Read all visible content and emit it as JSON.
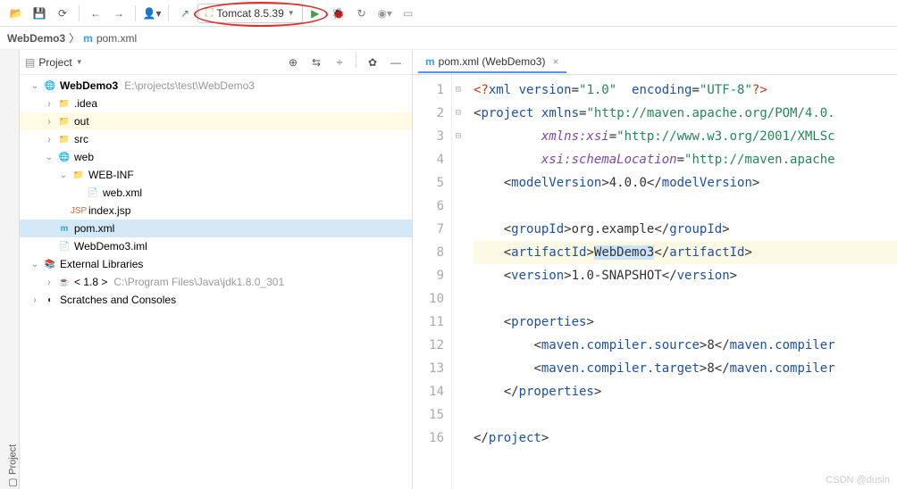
{
  "toolbar": {
    "run_config_label": "Tomcat 8.5.39"
  },
  "breadcrumb": {
    "project": "WebDemo3",
    "file": "pom.xml"
  },
  "project_pane": {
    "title": "Project",
    "tab_label": "Project"
  },
  "tree": [
    {
      "indent": 0,
      "arrow": "down",
      "icon": "folder-web",
      "label": "WebDemo3",
      "bold": true,
      "dim": "E:\\projects\\test\\WebDemo3",
      "cls": ""
    },
    {
      "indent": 1,
      "arrow": "right",
      "icon": "folder-gray",
      "label": ".idea",
      "dim": "",
      "cls": ""
    },
    {
      "indent": 1,
      "arrow": "right",
      "icon": "folder-out",
      "label": "out",
      "dim": "",
      "cls": "highlight"
    },
    {
      "indent": 1,
      "arrow": "right",
      "icon": "folder",
      "label": "src",
      "dim": "",
      "cls": ""
    },
    {
      "indent": 1,
      "arrow": "down",
      "icon": "folder-web",
      "label": "web",
      "dim": "",
      "cls": ""
    },
    {
      "indent": 2,
      "arrow": "down",
      "icon": "folder-gray",
      "label": "WEB-INF",
      "dim": "",
      "cls": ""
    },
    {
      "indent": 3,
      "arrow": "",
      "icon": "file-xml",
      "label": "web.xml",
      "dim": "",
      "cls": ""
    },
    {
      "indent": 2,
      "arrow": "",
      "icon": "file-jsp",
      "label": "index.jsp",
      "dim": "",
      "cls": ""
    },
    {
      "indent": 1,
      "arrow": "",
      "icon": "file-m",
      "label": "pom.xml",
      "dim": "",
      "cls": "selected"
    },
    {
      "indent": 1,
      "arrow": "",
      "icon": "file-generic",
      "label": "WebDemo3.iml",
      "dim": "",
      "cls": ""
    },
    {
      "indent": 0,
      "arrow": "down",
      "icon": "lib",
      "label": "External Libraries",
      "dim": "",
      "cls": ""
    },
    {
      "indent": 1,
      "arrow": "right",
      "icon": "jdk",
      "label": "< 1.8 >",
      "dim": "C:\\Program Files\\Java\\jdk1.8.0_301",
      "cls": ""
    },
    {
      "indent": 0,
      "arrow": "right",
      "icon": "scratch",
      "label": "Scratches and Consoles",
      "dim": "",
      "cls": ""
    }
  ],
  "editor": {
    "tab_label": "pom.xml (WebDemo3)",
    "lines": 16,
    "content": {
      "xml_decl": {
        "version": "1.0",
        "encoding": "UTF-8"
      },
      "project_attrs": {
        "xmlns": "http://maven.apache.org/POM/4.0.",
        "xmlns_xsi": "http://www.w3.org/2001/XMLSc",
        "xsi_schemaLocation": "http://maven.apache"
      },
      "modelVersion": "4.0.0",
      "groupId": "org.example",
      "artifactId": "WebDemo3",
      "version": "1.0-SNAPSHOT",
      "properties": {
        "maven_compiler_source": "8",
        "maven_compiler_target": "8"
      }
    }
  },
  "watermark": "CSDN @dusin"
}
